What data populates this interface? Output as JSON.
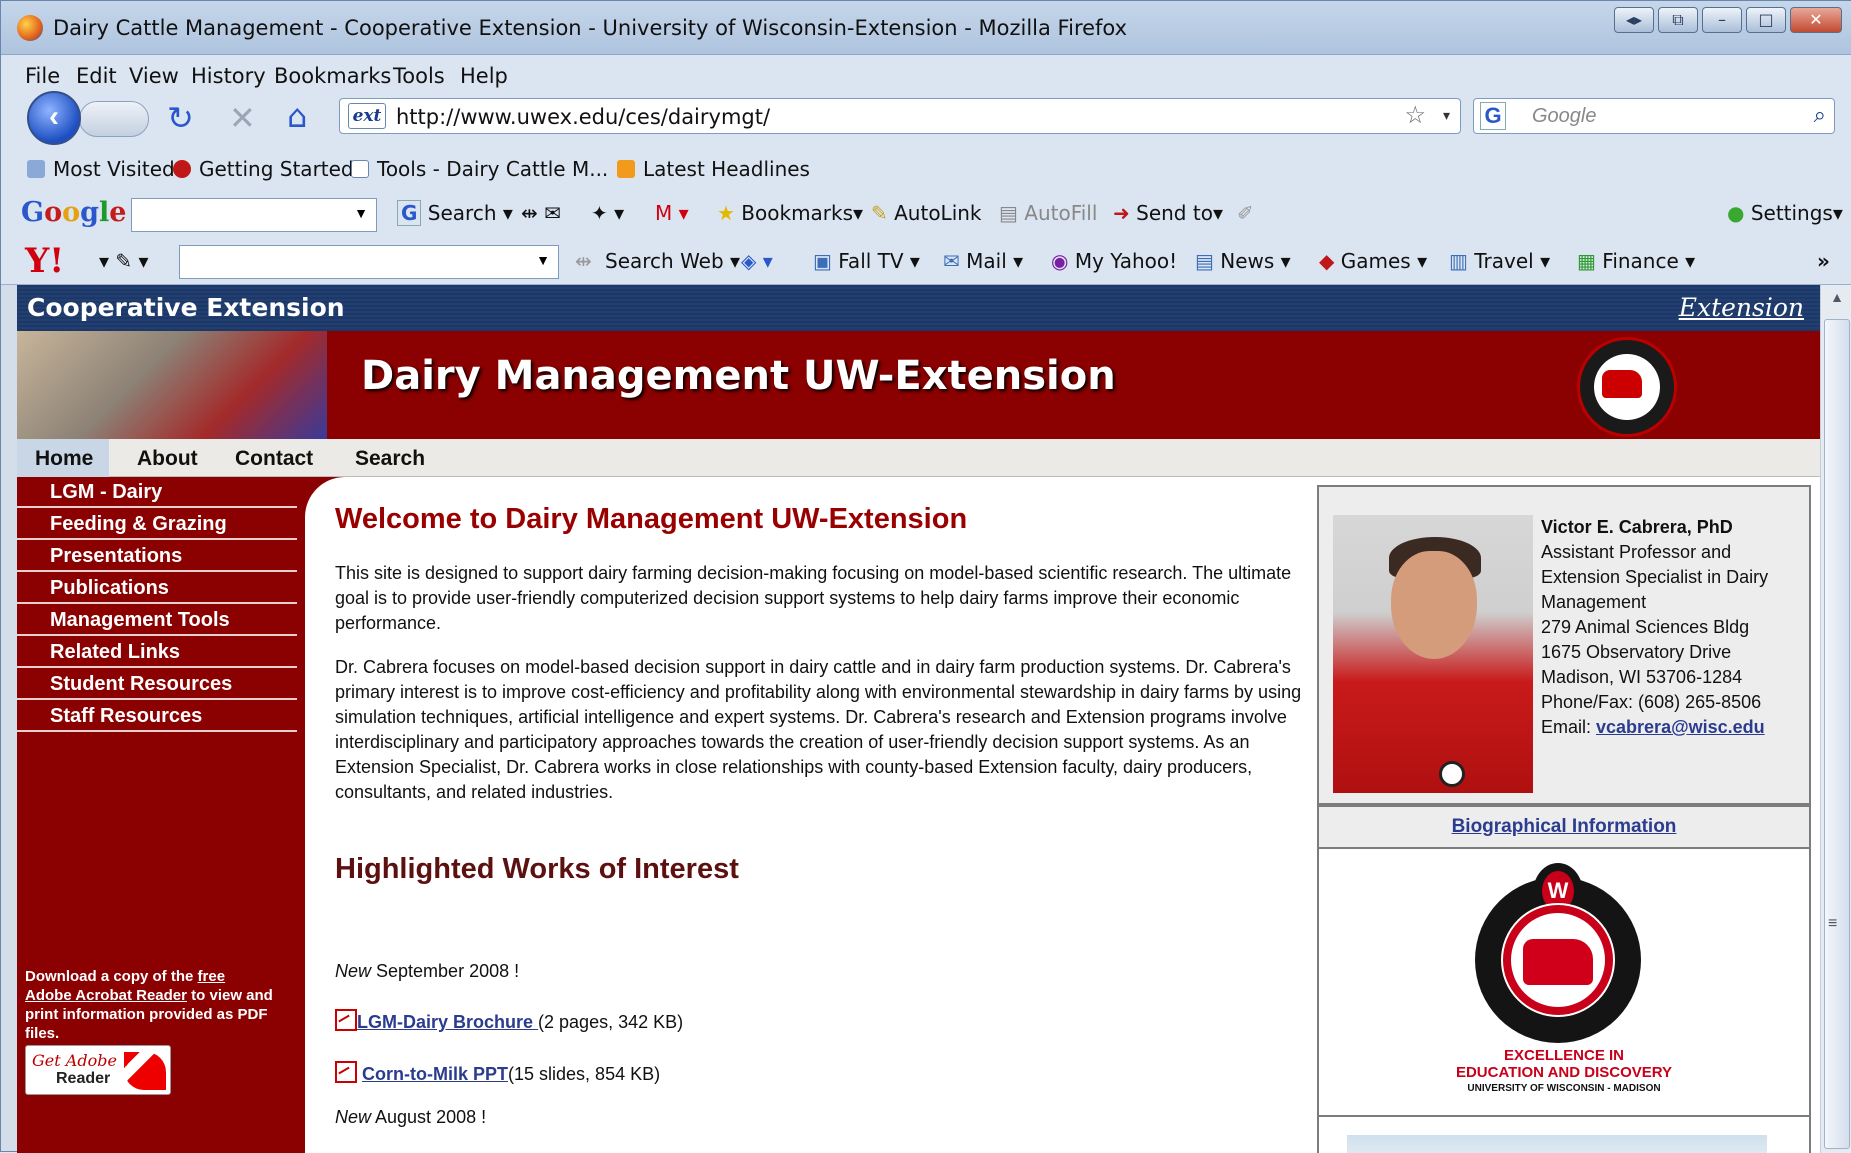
{
  "window": {
    "title": "Dairy Cattle Management - Cooperative Extension - University of Wisconsin-Extension - Mozilla Firefox"
  },
  "menu": [
    "File",
    "Edit",
    "View",
    "History",
    "Bookmarks",
    "Tools",
    "Help"
  ],
  "nav": {
    "url": "http://www.uwex.edu/ces/dairymgt/",
    "url_badge": "ext",
    "search_placeholder": "Google",
    "search_engine": "G"
  },
  "bookmarks": [
    "Most Visited",
    "Getting Started",
    "Tools - Dairy Cattle M...",
    "Latest Headlines"
  ],
  "google_toolbar": {
    "logo": "Google",
    "items": [
      "Search",
      "Bookmarks",
      "AutoLink",
      "AutoFill",
      "Send to",
      "Settings"
    ]
  },
  "yahoo_toolbar": {
    "logo": "Y!",
    "items": [
      "Search Web",
      "Fall TV",
      "Mail",
      "My Yahoo!",
      "News",
      "Games",
      "Travel",
      "Finance"
    ],
    "more": "»"
  },
  "page": {
    "header": {
      "org": "Cooperative Extension",
      "ext_logo": "Extension",
      "title": "Dairy Management UW-Extension"
    },
    "topnav": [
      "Home",
      "About",
      "Contact",
      "Search"
    ],
    "sidebar": {
      "items": [
        "LGM - Dairy",
        "Feeding & Grazing",
        "Presentations",
        "Publications",
        "Management Tools",
        "Related Links",
        "Student Resources",
        "Staff Resources"
      ],
      "pdf_note_1": "Download a copy of the ",
      "pdf_note_link1": "free",
      "pdf_note_link2": "Adobe Acrobat Reader",
      "pdf_note_2": " to view and print information provided as PDF files.",
      "adobe_get": "Get Adobe",
      "adobe_reader": "Reader"
    },
    "main": {
      "heading": "Welcome to Dairy Management UW-Extension",
      "para1": "This site is designed to support dairy farming decision-making focusing on model-based scientific research. The ultimate goal is to provide user-friendly computerized decision support systems to help dairy farms improve their economic performance.",
      "para2": "Dr. Cabrera focuses on model-based decision support in dairy cattle and in dairy farm production systems. Dr. Cabrera's primary interest is to improve cost-efficiency and profitability along with environmental stewardship in dairy farms by using simulation techniques, artificial intelligence and expert systems. Dr. Cabrera's research and Extension programs involve interdisciplinary and participatory approaches towards the creation of user-friendly decision support systems. As an Extension Specialist, Dr. Cabrera works in close relationships with county-based Extension faculty, dairy producers, consultants, and related industries.",
      "heading2": "Highlighted Works of Interest",
      "new1_label": "New",
      "new1_date": " September 2008 !",
      "doc1_link": "LGM-Dairy Brochure ",
      "doc1_info": "(2 pages, 342 KB)",
      "doc2_link": "Corn-to-Milk  PPT",
      "doc2_info": "(15 slides, 854 KB)",
      "new2_label": "New",
      "new2_date": " August 2008 !"
    },
    "profile": {
      "name": "Victor E. Cabrera, PhD",
      "title1": "Assistant Professor and",
      "title2": "Extension Specialist in Dairy",
      "title3": "Management",
      "addr1": "279 Animal Sciences Bldg",
      "addr2": "1675 Observatory Drive",
      "addr3": "Madison, WI 53706-1284",
      "phone": "Phone/Fax: (608) 265-8506",
      "email_label": "Email: ",
      "email": "vcabrera@wisc.edu",
      "bio_link": "Biographical Information"
    },
    "seal": {
      "line1": "EXCELLENCE IN",
      "line2": "EDUCATION AND DISCOVERY",
      "line3": "UNIVERSITY OF WISCONSIN - MADISON"
    }
  }
}
